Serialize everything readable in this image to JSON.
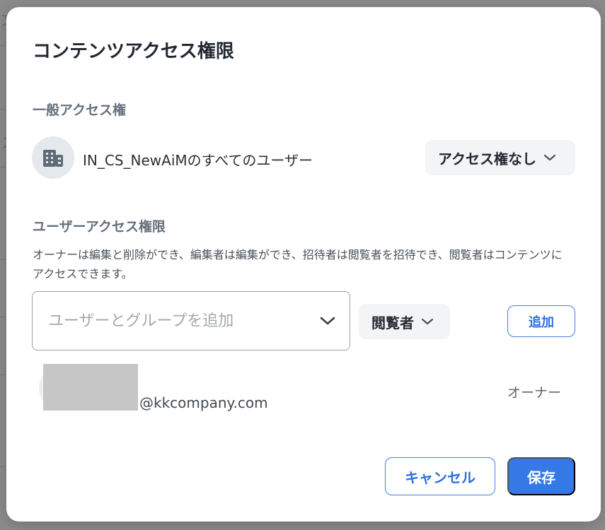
{
  "modal": {
    "title": "コンテンツアクセス権限",
    "general_access": {
      "heading": "一般アクセス権",
      "target_label": "IN_CS_NewAiMのすべてのユーザー",
      "target_icon": "building-icon",
      "access_level": "アクセス権なし"
    },
    "user_access": {
      "heading": "ユーザーアクセス権限",
      "description": "オーナーは編集と削除ができ、編集者は編集ができ、招待者は閲覧者を招待でき、閲覧者はコンテンツにアクセスできます。",
      "input_placeholder": "ユーザーとグループを追加",
      "role_select": "閲覧者",
      "add_button": "追加",
      "members": [
        {
          "email": "@kkcompany.com",
          "role": "オーナー"
        }
      ]
    },
    "footer": {
      "cancel_label": "キャンセル",
      "save_label": "保存"
    }
  },
  "colors": {
    "primary": "#3679e6",
    "chip_bg": "#f3f4f6",
    "heading_muted": "#66707c"
  }
}
